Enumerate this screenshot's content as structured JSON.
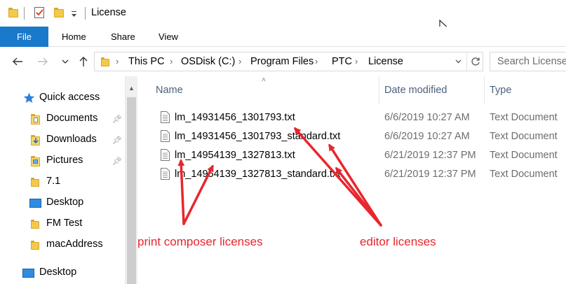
{
  "window": {
    "title": "License"
  },
  "ribbon": {
    "tabs": [
      {
        "label": "File"
      },
      {
        "label": "Home"
      },
      {
        "label": "Share"
      },
      {
        "label": "View"
      }
    ]
  },
  "address": {
    "crumbs": [
      "This PC",
      "OSDisk (C:)",
      "Program Files",
      "PTC",
      "License"
    ],
    "search_placeholder": "Search License"
  },
  "sidebar": {
    "items": [
      {
        "label": "Quick access",
        "icon": "star-icon",
        "pinned": false
      },
      {
        "label": "Documents",
        "icon": "documents-folder-icon",
        "pinned": true
      },
      {
        "label": "Downloads",
        "icon": "downloads-folder-icon",
        "pinned": true
      },
      {
        "label": "Pictures",
        "icon": "pictures-folder-icon",
        "pinned": true
      },
      {
        "label": "7.1",
        "icon": "folder-icon",
        "pinned": false
      },
      {
        "label": "Desktop",
        "icon": "desktop-icon",
        "pinned": false
      },
      {
        "label": "FM Test",
        "icon": "folder-icon",
        "pinned": false
      },
      {
        "label": "macAddress",
        "icon": "folder-icon",
        "pinned": false
      },
      {
        "label": "Desktop",
        "icon": "desktop-icon",
        "pinned": false
      }
    ]
  },
  "list": {
    "columns": [
      "Name",
      "Date modified",
      "Type"
    ],
    "rows": [
      {
        "name": "lm_14931456_1301793.txt",
        "date": "6/6/2019 10:27 AM",
        "type": "Text Document"
      },
      {
        "name": "lm_14931456_1301793_standard.txt",
        "date": "6/6/2019 10:27 AM",
        "type": "Text Document"
      },
      {
        "name": "lm_14954139_1327813.txt",
        "date": "6/21/2019 12:37 PM",
        "type": "Text Document"
      },
      {
        "name": "lm_14954139_1327813_standard.txt",
        "date": "6/21/2019 12:37 PM",
        "type": "Text Document"
      }
    ]
  },
  "annotations": {
    "left_label": "print composer licenses",
    "right_label": "editor licenses",
    "color": "#e8262d"
  },
  "colors": {
    "file_tab": "#1979ca",
    "folder": "#f3c94c",
    "column_header": "#4c607a"
  }
}
